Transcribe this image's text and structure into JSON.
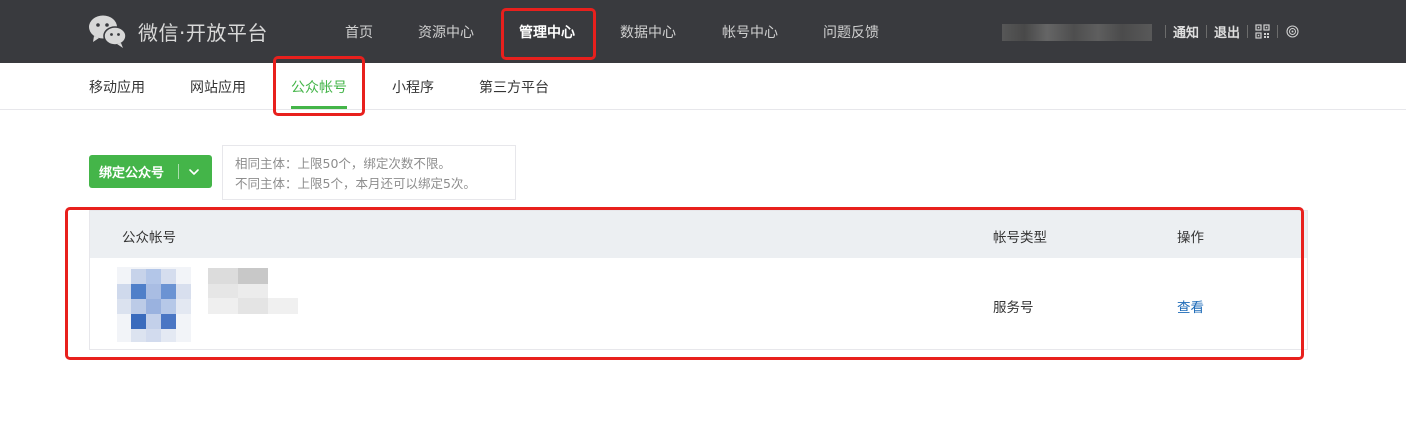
{
  "header": {
    "brand_title": "微信·开放平台",
    "nav": [
      {
        "label": "首页"
      },
      {
        "label": "资源中心"
      },
      {
        "label": "管理中心",
        "active": true
      },
      {
        "label": "数据中心"
      },
      {
        "label": "帐号中心"
      },
      {
        "label": "问题反馈"
      }
    ],
    "links": {
      "notify": "通知",
      "logout": "退出"
    }
  },
  "subnav": {
    "items": [
      {
        "label": "移动应用"
      },
      {
        "label": "网站应用"
      },
      {
        "label": "公众帐号",
        "active": true
      },
      {
        "label": "小程序"
      },
      {
        "label": "第三方平台"
      }
    ]
  },
  "actions": {
    "bind_label": "绑定公众号",
    "tip_line1": "相同主体：上限50个，绑定次数不限。",
    "tip_line2": "不同主体：上限5个，本月还可以绑定5次。"
  },
  "table": {
    "columns": {
      "account": "公众帐号",
      "type": "帐号类型",
      "ops": "操作"
    },
    "rows": [
      {
        "type": "服务号",
        "action": "查看"
      }
    ]
  },
  "colors": {
    "topbar": "#393a3e",
    "accent": "#44b549",
    "link": "#1e6bb8",
    "annotation": "#e8201d"
  }
}
